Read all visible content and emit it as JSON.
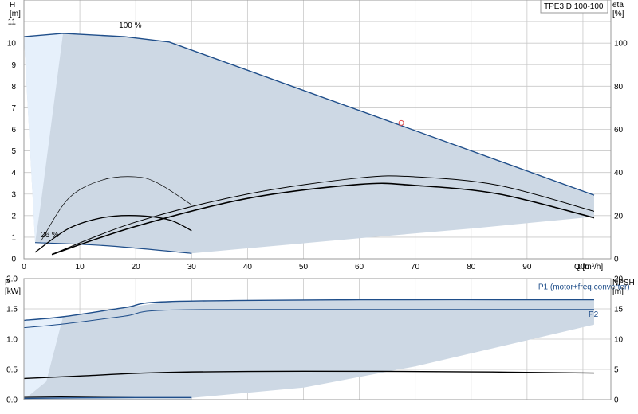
{
  "colors": {
    "envelope": "#cdd8e4",
    "envelope_light": "#e6f0fb",
    "grid": "#c9c9c9",
    "curve_blue": "#1f4e8a",
    "curve_black": "#000000",
    "marker": "#e05050"
  },
  "chart_data": [
    {
      "type": "line",
      "title": "TPE3 D 100-100",
      "xlabel": "Q [m³/h]",
      "ylabel": "H\n[m]",
      "ylabel_right": "eta\n[%]",
      "xlim": [
        0,
        105
      ],
      "ylim": [
        0,
        12
      ],
      "x_ticks": [
        0,
        10,
        20,
        30,
        40,
        50,
        60,
        70,
        80,
        90,
        100
      ],
      "y_ticks": [
        0,
        1,
        2,
        3,
        4,
        5,
        6,
        7,
        8,
        9,
        10,
        11
      ],
      "y_right_ticks": [
        0,
        20,
        40,
        60,
        80,
        100
      ],
      "y_right_range": [
        0,
        120
      ],
      "grid": true,
      "annotations": [
        {
          "text": "100 %",
          "x": 17,
          "y": 10.7
        },
        {
          "text": "26 %",
          "x": 3,
          "y": 1.0
        }
      ],
      "duty_point": {
        "x": 67.5,
        "y": 6.3
      },
      "series": [
        {
          "role": "envelope",
          "x": [
            0,
            7,
            18,
            26,
            102,
            102,
            80,
            60,
            45,
            30,
            30,
            15,
            2
          ],
          "y": [
            10.3,
            10.45,
            10.3,
            10.05,
            2.95,
            1.95,
            1.4,
            0.95,
            0.6,
            0.25,
            0.3,
            0.6,
            0.75
          ]
        },
        {
          "role": "envelope_light",
          "x": [
            0,
            7,
            3,
            2
          ],
          "y": [
            10.3,
            10.45,
            2.5,
            0.75
          ]
        },
        {
          "role": "H_max",
          "x": [
            0,
            7,
            18,
            26,
            102
          ],
          "y": [
            10.3,
            10.45,
            10.3,
            10.05,
            2.95
          ]
        },
        {
          "role": "H_min",
          "x": [
            2,
            15,
            30
          ],
          "y": [
            0.75,
            0.6,
            0.25
          ]
        },
        {
          "role": "eta_total_max",
          "x": [
            5,
            20,
            40,
            60,
            70,
            85,
            102
          ],
          "y": [
            2,
            17,
            30,
            37.5,
            38,
            34,
            22
          ]
        },
        {
          "role": "eta_total_max_2",
          "x": [
            5,
            20,
            40,
            60,
            70,
            85,
            102
          ],
          "y": [
            2,
            15,
            28,
            34.5,
            34,
            30,
            19
          ]
        },
        {
          "role": "eta_total_min",
          "x": [
            2,
            8,
            14,
            20,
            26,
            30
          ],
          "y": [
            3,
            14,
            19,
            20,
            18,
            13
          ]
        },
        {
          "role": "eta_total_min_2",
          "x": [
            3,
            8,
            14,
            20,
            24,
            30
          ],
          "y": [
            8,
            28,
            36.5,
            38,
            35,
            25
          ]
        }
      ]
    },
    {
      "type": "line",
      "ylabel": "P\n[kW]",
      "ylabel_right": "NPSH\n[m]",
      "xlim": [
        0,
        105
      ],
      "ylim": [
        0,
        2.0
      ],
      "y_ticks": [
        0,
        0.5,
        1.0,
        1.5,
        2.0
      ],
      "y_right_ticks": [
        0,
        5,
        10,
        15,
        20
      ],
      "y_right_range": [
        0,
        20
      ],
      "grid": true,
      "annotations": [
        {
          "text": "P1 (motor+freq.converter)",
          "x": 92,
          "y": 1.82
        },
        {
          "text": "P2",
          "x": 101,
          "y": 1.37
        }
      ],
      "series": [
        {
          "name": "P1 (motor+freq.converter)",
          "role": "P1",
          "x": [
            0,
            7,
            18,
            26,
            60,
            102
          ],
          "y": [
            1.31,
            1.37,
            1.52,
            1.62,
            1.65,
            1.65
          ]
        },
        {
          "name": "P2",
          "role": "P2",
          "x": [
            0,
            7,
            18,
            26,
            60,
            102
          ],
          "y": [
            1.19,
            1.25,
            1.38,
            1.48,
            1.49,
            1.49
          ]
        },
        {
          "role": "NPSH",
          "x": [
            0,
            10,
            25,
            50,
            80,
            102
          ],
          "y": [
            3.5,
            3.9,
            4.5,
            4.7,
            4.6,
            4.4
          ]
        },
        {
          "role": "P_min",
          "x": [
            0,
            10,
            20,
            30
          ],
          "y": [
            0.02,
            0.03,
            0.035,
            0.035
          ]
        },
        {
          "role": "P_min_2",
          "x": [
            0,
            10,
            20,
            30
          ],
          "y": [
            0.04,
            0.05,
            0.06,
            0.06
          ]
        },
        {
          "role": "envelope",
          "x": [
            0,
            7,
            18,
            26,
            60,
            102,
            102,
            70,
            50,
            30,
            30,
            0
          ],
          "y": [
            1.31,
            1.37,
            1.52,
            1.62,
            1.65,
            1.65,
            1.24,
            0.55,
            0.2,
            0.03,
            0.0,
            0.0
          ]
        },
        {
          "role": "envelope_light",
          "x": [
            0,
            7,
            4,
            0
          ],
          "y": [
            1.31,
            1.37,
            0.3,
            0.0
          ]
        }
      ]
    }
  ]
}
